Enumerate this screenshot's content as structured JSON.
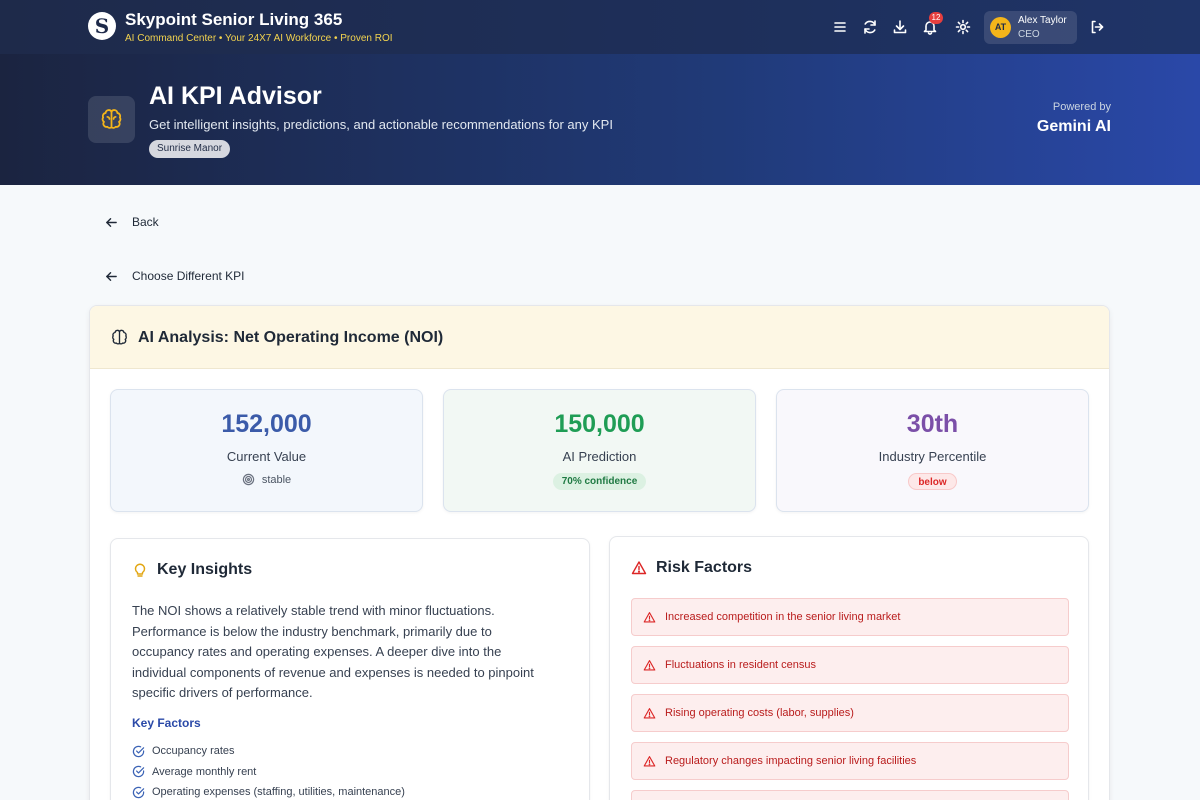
{
  "header": {
    "brand_title": "Skypoint Senior Living 365",
    "brand_subtitle": "AI Command Center • Your 24X7 AI Workforce • Proven ROI",
    "notification_count": "12",
    "user": {
      "initials": "AT",
      "name": "Alex Taylor",
      "role": "CEO"
    },
    "icons": [
      "menu-icon",
      "refresh-icon",
      "download-icon",
      "bell-icon",
      "gear-icon",
      "logout-icon"
    ]
  },
  "hero": {
    "title": "AI KPI Advisor",
    "subtitle": "Get intelligent insights, predictions, and actionable recommendations for any KPI",
    "facility_badge": "Sunrise Manor",
    "powered_by_label": "Powered by",
    "powered_by_name": "Gemini AI"
  },
  "nav": {
    "back_label": "Back",
    "choose_kpi_label": "Choose Different KPI"
  },
  "analysis": {
    "title": "AI Analysis: Net Operating Income (NOI)",
    "stats": [
      {
        "value": "152,000",
        "label": "Current Value",
        "extra": "stable",
        "color": "#3b5ba9"
      },
      {
        "value": "150,000",
        "label": "AI Prediction",
        "extra": "70% confidence",
        "color": "#1f9d55"
      },
      {
        "value": "30th",
        "label": "Industry Percentile",
        "extra": "below",
        "color": "#7b4fa8"
      }
    ],
    "insights": {
      "title": "Key Insights",
      "text": "The NOI shows a relatively stable trend with minor fluctuations. Performance is below the industry benchmark, primarily due to occupancy rates and operating expenses. A deeper dive into the individual components of revenue and expenses is needed to pinpoint specific drivers of performance.",
      "factors_title": "Key Factors",
      "factors": [
        "Occupancy rates",
        "Average monthly rent",
        "Operating expenses (staffing, utilities, maintenance)"
      ]
    },
    "risks": {
      "title": "Risk Factors",
      "items": [
        "Increased competition in the senior living market",
        "Fluctuations in resident census",
        "Rising operating costs (labor, supplies)",
        "Regulatory changes impacting senior living facilities",
        ""
      ]
    }
  },
  "colors": {
    "nav_bg": "#1e2a4a",
    "accent_yellow": "#f2d34f",
    "risk_red": "#b91c1c",
    "link_blue": "#2b4aa8"
  }
}
